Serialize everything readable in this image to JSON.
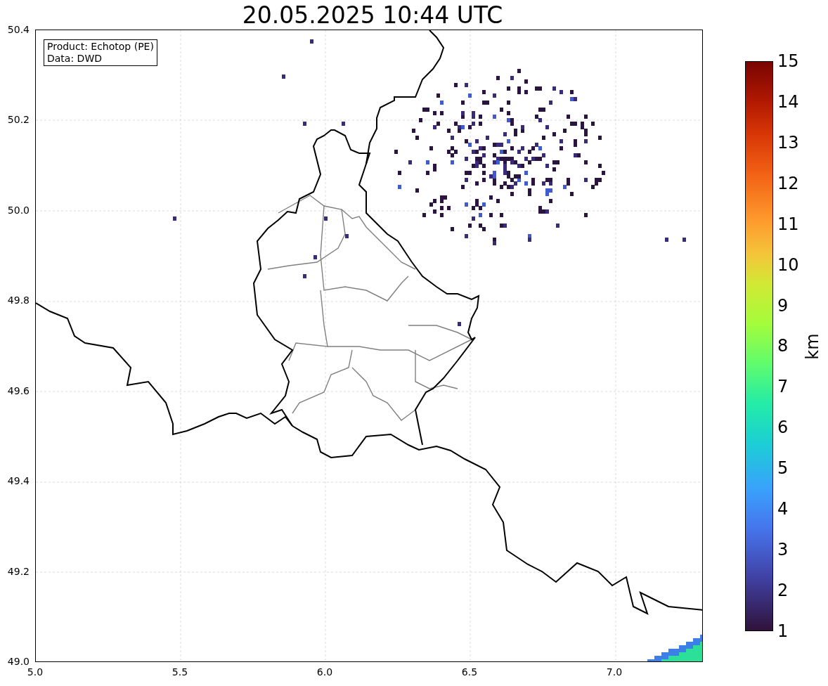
{
  "title": "20.05.2025 10:44 UTC",
  "info_box": [
    "Product: Echotop (PE)",
    "Data: DWD"
  ],
  "map": {
    "yticks": [
      "50.4",
      "50.2",
      "50.0",
      "49.8",
      "49.6",
      "49.4",
      "49.2",
      "49.0"
    ],
    "xticks": [
      "5.0",
      "5.5",
      "6.0",
      "6.5",
      "7.0"
    ]
  },
  "colorbar": {
    "label": "km",
    "ticks": [
      "15",
      "14",
      "13",
      "12",
      "11",
      "10",
      "9",
      "8",
      "7",
      "6",
      "5",
      "4",
      "3",
      "2",
      "1"
    ]
  }
}
